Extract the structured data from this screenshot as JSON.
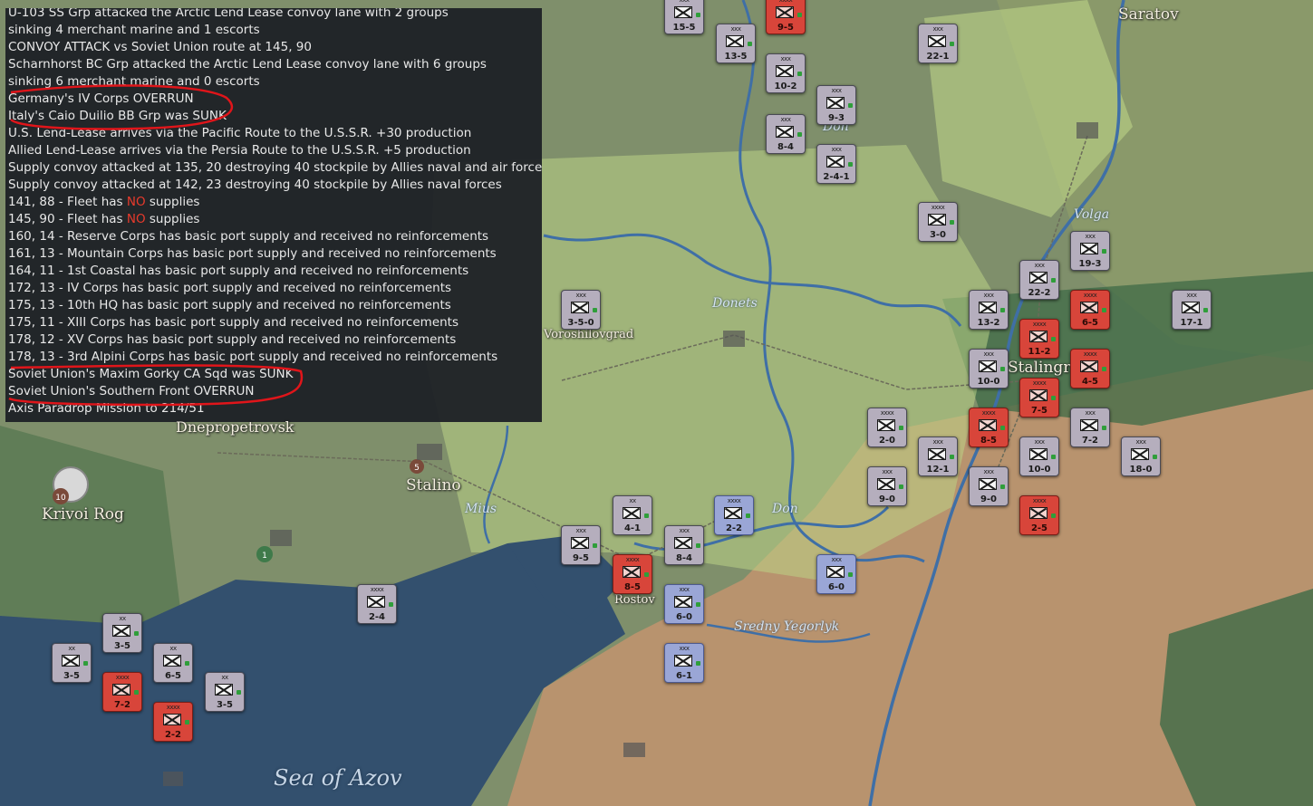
{
  "log": {
    "lines": [
      "U-103 SS Grp attacked the Arctic Lend Lease convoy lane with 2 groups",
      "   sinking 4 merchant marine and 1 escorts",
      "CONVOY ATTACK vs Soviet Union route at 145, 90",
      "Scharnhorst BC Grp attacked the Arctic Lend Lease convoy lane with 6 groups",
      "   sinking 6 merchant marine and 0 escorts",
      "Germany's IV Corps OVERRUN",
      "Italy's Caio Duilio BB Grp was SUNK",
      "U.S. Lend-Lease arrives via the Pacific Route to the U.S.S.R. +30 production",
      "Allied Lend-Lease arrives via the Persia Route to the U.S.S.R. +5 production",
      "Supply convoy attacked at 135, 20 destroying 40 stockpile by Allies naval and air forces",
      "Supply convoy attacked at 142, 23 destroying 40 stockpile by Allies naval forces",
      "160, 14 - Reserve Corps has basic port supply and received no reinforcements",
      "161, 13 - Mountain Corps has basic port supply and received no reinforcements",
      "164, 11 - 1st Coastal has basic port supply and received no reinforcements",
      "172, 13 - IV Corps has basic port supply and received no reinforcements",
      "175, 13 - 10th HQ has basic port supply and received no reinforcements",
      "175, 11 - XIII Corps has basic port supply and received no reinforcements",
      "178, 12 - XV Corps has basic port supply and received no reinforcements",
      "178, 13 - 3rd Alpini Corps has basic port supply and received no reinforcements",
      "Soviet Union's Maxim Gorky CA Sqd was SUNK",
      "Soviet Union's Southern Front OVERRUN",
      "Axis Paradrop Mission to 214/51"
    ],
    "fleet_lines": [
      {
        "prefix": "141, 88 - Fleet has ",
        "red": "NO",
        "suffix": " supplies"
      },
      {
        "prefix": "145, 90 - Fleet has ",
        "red": "NO",
        "suffix": " supplies"
      }
    ]
  },
  "cities": [
    {
      "name": "Saratov"
    },
    {
      "name": "Stalingrad"
    },
    {
      "name": "Voroshilovgrad"
    },
    {
      "name": "Dnepropetrovsk"
    },
    {
      "name": "Stalino"
    },
    {
      "name": "Krivoi Rog"
    },
    {
      "name": "Rostov"
    }
  ],
  "rivers": [
    "Don",
    "Volga",
    "Donets",
    "Mius",
    "Don",
    "Sredny Yegorlyk"
  ],
  "seas": [
    "Sea of Azov"
  ],
  "city_values": [
    "10",
    "5",
    "1"
  ],
  "units": [
    {
      "side": "axis",
      "size": "xxx",
      "str": "15-5"
    },
    {
      "side": "axis",
      "size": "xxx",
      "str": "13-5"
    },
    {
      "side": "soviet",
      "size": "xxxx",
      "str": "9-5"
    },
    {
      "side": "axis",
      "size": "xxx",
      "str": "10-2"
    },
    {
      "side": "axis",
      "size": "xxx",
      "str": "9-3"
    },
    {
      "side": "axis",
      "size": "xxx",
      "str": "8-4"
    },
    {
      "side": "axis",
      "size": "xxx",
      "str": "2-4-1"
    },
    {
      "side": "axis",
      "size": "xxx",
      "str": "22-1"
    },
    {
      "side": "axis",
      "size": "xxxx",
      "str": "3-0"
    },
    {
      "side": "axis",
      "size": "xxx",
      "str": "19-3"
    },
    {
      "side": "axis",
      "size": "xxx",
      "str": "22-2"
    },
    {
      "side": "axis",
      "size": "xxx",
      "str": "13-2"
    },
    {
      "side": "soviet",
      "size": "xxxx",
      "str": "11-2"
    },
    {
      "side": "soviet",
      "size": "xxxx",
      "str": "6-5"
    },
    {
      "side": "axis",
      "size": "xxx",
      "str": "17-1"
    },
    {
      "side": "axis",
      "size": "xxx",
      "str": "10-0"
    },
    {
      "side": "soviet",
      "size": "xxxx",
      "str": "4-5"
    },
    {
      "side": "soviet",
      "size": "xxxx",
      "str": "7-5"
    },
    {
      "side": "axis",
      "size": "xxx",
      "str": "3-5-0"
    },
    {
      "side": "axis",
      "size": "xxxx",
      "str": "2-0"
    },
    {
      "side": "soviet",
      "size": "xxxx",
      "str": "8-5"
    },
    {
      "side": "axis",
      "size": "xxx",
      "str": "12-1"
    },
    {
      "side": "axis",
      "size": "xxx",
      "str": "10-0"
    },
    {
      "side": "axis",
      "size": "xxx",
      "str": "7-2"
    },
    {
      "side": "axis",
      "size": "xxx",
      "str": "18-0"
    },
    {
      "side": "axis",
      "size": "xxx",
      "str": "9-0"
    },
    {
      "side": "axis",
      "size": "xxx",
      "str": "9-0"
    },
    {
      "side": "soviet",
      "size": "xxxx",
      "str": "2-5"
    },
    {
      "side": "axis",
      "size": "xx",
      "str": "4-1"
    },
    {
      "side": "allied",
      "size": "xxxx",
      "str": "2-2"
    },
    {
      "side": "axis",
      "size": "xxx",
      "str": "9-5"
    },
    {
      "side": "axis",
      "size": "xxx",
      "str": "8-4"
    },
    {
      "side": "soviet",
      "size": "xxxx",
      "str": "8-5"
    },
    {
      "side": "allied",
      "size": "xxx",
      "str": "6-0"
    },
    {
      "side": "allied",
      "size": "xxx",
      "str": "6-0"
    },
    {
      "side": "allied",
      "size": "xxx",
      "str": "6-1"
    },
    {
      "side": "axis",
      "size": "xxxx",
      "str": "2-4"
    },
    {
      "side": "axis",
      "size": "xx",
      "str": "3-5"
    },
    {
      "side": "axis",
      "size": "xx",
      "str": "3-5"
    },
    {
      "side": "axis",
      "size": "xx",
      "str": "6-5"
    },
    {
      "side": "axis",
      "size": "xx",
      "str": "3-5"
    },
    {
      "side": "soviet",
      "size": "xxxx",
      "str": "7-2"
    },
    {
      "side": "soviet",
      "size": "xxxx",
      "str": "2-2"
    }
  ],
  "colors": {
    "sea": "#33506e",
    "steppe": "#7d8f6a",
    "sovietTerritory": "#b8936e",
    "highlight": "#c5d98a",
    "overlay": "#1e2126",
    "redText": "#e83a2c"
  }
}
